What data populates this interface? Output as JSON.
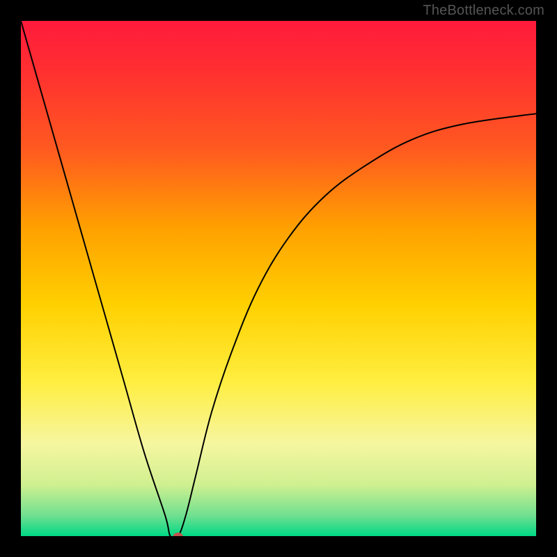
{
  "watermark": "TheBottleneck.com",
  "chart_data": {
    "type": "line",
    "title": "",
    "xlabel": "",
    "ylabel": "",
    "xlim": [
      0,
      100
    ],
    "ylim": [
      0,
      100
    ],
    "background_gradient": {
      "stops": [
        {
          "offset": 0.0,
          "color": "#ff1a3c"
        },
        {
          "offset": 0.1,
          "color": "#ff3030"
        },
        {
          "offset": 0.25,
          "color": "#ff5a20"
        },
        {
          "offset": 0.4,
          "color": "#ffa000"
        },
        {
          "offset": 0.55,
          "color": "#ffd000"
        },
        {
          "offset": 0.7,
          "color": "#ffee40"
        },
        {
          "offset": 0.82,
          "color": "#f6f6a0"
        },
        {
          "offset": 0.9,
          "color": "#d0f090"
        },
        {
          "offset": 0.96,
          "color": "#70e090"
        },
        {
          "offset": 1.0,
          "color": "#00d885"
        }
      ]
    },
    "series": [
      {
        "name": "bottleneck-curve",
        "color": "#000000",
        "width": 2.0,
        "x": [
          0,
          4,
          8,
          12,
          16,
          20,
          24,
          28,
          29,
          30.5,
          32,
          34,
          37,
          41,
          46,
          52,
          59,
          67,
          76,
          86,
          100
        ],
        "y": [
          100,
          86,
          72,
          58,
          44,
          30,
          16,
          4,
          0,
          0,
          4,
          12,
          24,
          36,
          48,
          58,
          66,
          72,
          77,
          80,
          82
        ]
      }
    ],
    "marker": {
      "name": "optimal-point",
      "x": 30.5,
      "y": 0,
      "rx": 7,
      "ry": 5,
      "color": "#c0544c"
    }
  }
}
